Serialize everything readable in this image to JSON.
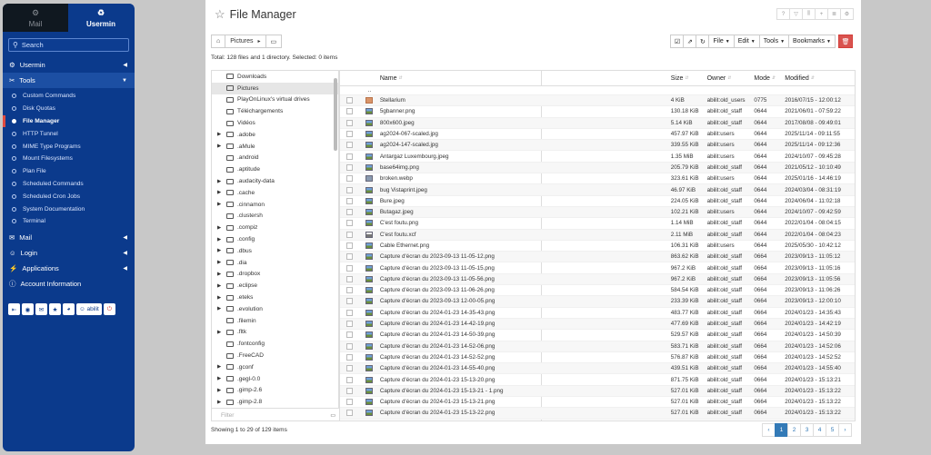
{
  "sidebar": {
    "tabs": [
      {
        "label": "Mail",
        "icon": "gear-icon"
      },
      {
        "label": "Usermin",
        "icon": "recycle-icon"
      }
    ],
    "search_placeholder": "Search",
    "sections": [
      {
        "label": "Usermin",
        "icon": "gear-icon",
        "expanded": false
      },
      {
        "label": "Tools",
        "icon": "wrench-icon",
        "expanded": true
      },
      {
        "label": "Mail",
        "icon": "envelope-icon",
        "expanded": false
      },
      {
        "label": "Login",
        "icon": "user-icon",
        "expanded": false
      },
      {
        "label": "Applications",
        "icon": "bolt-icon",
        "expanded": false
      },
      {
        "label": "Account Information",
        "icon": "info-icon",
        "expanded": false
      }
    ],
    "tools_items": [
      "Custom Commands",
      "Disk Quotas",
      "File Manager",
      "HTTP Tunnel",
      "MIME Type Programs",
      "Mount Filesystems",
      "Plan File",
      "Scheduled Commands",
      "Scheduled Cron Jobs",
      "System Documentation",
      "Terminal"
    ],
    "current_item": "File Manager",
    "username": "abilit"
  },
  "header": {
    "title": "File Manager"
  },
  "breadcrumb": {
    "current": "Pictures"
  },
  "toolbar": {
    "file_label": "File",
    "edit_label": "Edit",
    "tools_label": "Tools",
    "bookmarks_label": "Bookmarks"
  },
  "total_text": "Total: 128 files and 1 directory. Selected: 0 items",
  "tree": {
    "filter_placeholder": "Filter",
    "items": [
      {
        "name": "Downloads",
        "expandable": false,
        "selected": false
      },
      {
        "name": "Pictures",
        "expandable": false,
        "selected": true
      },
      {
        "name": "PlayOnLinux's virtual drives",
        "expandable": false,
        "selected": false
      },
      {
        "name": "Téléchargements",
        "expandable": false,
        "selected": false
      },
      {
        "name": "Vidéos",
        "expandable": false,
        "selected": false
      },
      {
        "name": ".adobe",
        "expandable": true,
        "selected": false
      },
      {
        "name": ".aMule",
        "expandable": true,
        "selected": false
      },
      {
        "name": ".android",
        "expandable": false,
        "selected": false
      },
      {
        "name": ".aptitude",
        "expandable": false,
        "selected": false
      },
      {
        "name": ".audacity-data",
        "expandable": true,
        "selected": false
      },
      {
        "name": ".cache",
        "expandable": true,
        "selected": false
      },
      {
        "name": ".cinnamon",
        "expandable": true,
        "selected": false
      },
      {
        "name": ".clustersh",
        "expandable": false,
        "selected": false
      },
      {
        "name": ".compiz",
        "expandable": true,
        "selected": false
      },
      {
        "name": ".config",
        "expandable": true,
        "selected": false
      },
      {
        "name": ".dbus",
        "expandable": true,
        "selected": false
      },
      {
        "name": ".dia",
        "expandable": true,
        "selected": false
      },
      {
        "name": ".dropbox",
        "expandable": true,
        "selected": false
      },
      {
        "name": ".eclipse",
        "expandable": true,
        "selected": false
      },
      {
        "name": ".eteks",
        "expandable": true,
        "selected": false
      },
      {
        "name": ".evolution",
        "expandable": true,
        "selected": false
      },
      {
        "name": ".filemin",
        "expandable": false,
        "selected": false
      },
      {
        "name": ".fltk",
        "expandable": true,
        "selected": false
      },
      {
        "name": ".fontconfig",
        "expandable": false,
        "selected": false
      },
      {
        "name": ".FreeCAD",
        "expandable": false,
        "selected": false
      },
      {
        "name": ".gconf",
        "expandable": true,
        "selected": false
      },
      {
        "name": ".gegl-0.0",
        "expandable": true,
        "selected": false
      },
      {
        "name": ".gimp-2.6",
        "expandable": true,
        "selected": false
      },
      {
        "name": ".gimp-2.8",
        "expandable": true,
        "selected": false
      }
    ]
  },
  "table": {
    "headers": {
      "name": "Name",
      "size": "Size",
      "owner": "Owner",
      "mode": "Mode",
      "modified": "Modified"
    },
    "parent_row": "..",
    "rows": [
      {
        "icon": "folder",
        "name": "Stellarium",
        "size": "4 KiB",
        "owner": "abilit:old_users",
        "mode": "0775",
        "modified": "2016/07/15 - 12:00:12"
      },
      {
        "icon": "img",
        "name": "5gbanner.png",
        "size": "130.18 KiB",
        "owner": "abilit:old_staff",
        "mode": "0644",
        "modified": "2021/06/01 - 07:59:22"
      },
      {
        "icon": "img",
        "name": "800x600.jpeg",
        "size": "5.14 KiB",
        "owner": "abilit:old_staff",
        "mode": "0644",
        "modified": "2017/08/08 - 09:49:01"
      },
      {
        "icon": "img",
        "name": "ag2024-067-scaled.jpg",
        "size": "457.97 KiB",
        "owner": "abilit:users",
        "mode": "0644",
        "modified": "2025/11/14 - 09:11:55"
      },
      {
        "icon": "img",
        "name": "ag2024-147-scaled.jpg",
        "size": "339.55 KiB",
        "owner": "abilit:users",
        "mode": "0644",
        "modified": "2025/11/14 - 09:12:36"
      },
      {
        "icon": "img",
        "name": "Antargaz Luxembourg.jpeg",
        "size": "1.35 MiB",
        "owner": "abilit:users",
        "mode": "0644",
        "modified": "2024/10/07 - 09:45:28"
      },
      {
        "icon": "img",
        "name": "base64img.png",
        "size": "205.79 KiB",
        "owner": "abilit:old_staff",
        "mode": "0644",
        "modified": "2021/05/12 - 10:10:49"
      },
      {
        "icon": "file",
        "name": "broken.webp",
        "size": "323.61 KiB",
        "owner": "abilit:users",
        "mode": "0644",
        "modified": "2025/01/16 - 14:46:19"
      },
      {
        "icon": "img",
        "name": "bug Vistaprint.jpeg",
        "size": "46.97 KiB",
        "owner": "abilit:old_staff",
        "mode": "0644",
        "modified": "2024/03/04 - 08:31:19"
      },
      {
        "icon": "img",
        "name": "Bure.jpeg",
        "size": "224.05 KiB",
        "owner": "abilit:old_staff",
        "mode": "0644",
        "modified": "2024/06/04 - 11:02:18"
      },
      {
        "icon": "img",
        "name": "Butagaz.jpeg",
        "size": "102.21 KiB",
        "owner": "abilit:users",
        "mode": "0644",
        "modified": "2024/10/07 - 09:42:59"
      },
      {
        "icon": "img",
        "name": "C'est foutu.png",
        "size": "1.14 MiB",
        "owner": "abilit:old_staff",
        "mode": "0644",
        "modified": "2022/01/04 - 08:04:15"
      },
      {
        "icon": "xcf",
        "name": "C'est foutu.xcf",
        "size": "2.11 MiB",
        "owner": "abilit:old_staff",
        "mode": "0644",
        "modified": "2022/01/04 - 08:04:23"
      },
      {
        "icon": "img",
        "name": "Cable Ethernet.png",
        "size": "106.31 KiB",
        "owner": "abilit:users",
        "mode": "0644",
        "modified": "2025/05/30 - 10:42:12"
      },
      {
        "icon": "img",
        "name": "Capture d'écran du 2023-09-13 11-05-12.png",
        "size": "863.62 KiB",
        "owner": "abilit:old_staff",
        "mode": "0664",
        "modified": "2023/09/13 - 11:05:12"
      },
      {
        "icon": "img",
        "name": "Capture d'écran du 2023-09-13 11-05-15.png",
        "size": "967.2 KiB",
        "owner": "abilit:old_staff",
        "mode": "0664",
        "modified": "2023/09/13 - 11:05:16"
      },
      {
        "icon": "img",
        "name": "Capture d'écran du 2023-09-13 11-05-56.png",
        "size": "967.2 KiB",
        "owner": "abilit:old_staff",
        "mode": "0664",
        "modified": "2023/09/13 - 11:05:56"
      },
      {
        "icon": "img",
        "name": "Capture d'écran du 2023-09-13 11-06-26.png",
        "size": "584.54 KiB",
        "owner": "abilit:old_staff",
        "mode": "0664",
        "modified": "2023/09/13 - 11:06:26"
      },
      {
        "icon": "img",
        "name": "Capture d'écran du 2023-09-13 12-00-05.png",
        "size": "233.39 KiB",
        "owner": "abilit:old_staff",
        "mode": "0664",
        "modified": "2023/09/13 - 12:00:10"
      },
      {
        "icon": "img",
        "name": "Capture d'écran du 2024-01-23 14-35-43.png",
        "size": "483.77 KiB",
        "owner": "abilit:old_staff",
        "mode": "0664",
        "modified": "2024/01/23 - 14:35:43"
      },
      {
        "icon": "img",
        "name": "Capture d'écran du 2024-01-23 14-42-19.png",
        "size": "477.69 KiB",
        "owner": "abilit:old_staff",
        "mode": "0664",
        "modified": "2024/01/23 - 14:42:19"
      },
      {
        "icon": "img",
        "name": "Capture d'écran du 2024-01-23 14-50-39.png",
        "size": "529.57 KiB",
        "owner": "abilit:old_staff",
        "mode": "0664",
        "modified": "2024/01/23 - 14:50:39"
      },
      {
        "icon": "img",
        "name": "Capture d'écran du 2024-01-23 14-52-06.png",
        "size": "583.71 KiB",
        "owner": "abilit:old_staff",
        "mode": "0664",
        "modified": "2024/01/23 - 14:52:06"
      },
      {
        "icon": "img",
        "name": "Capture d'écran du 2024-01-23 14-52-52.png",
        "size": "576.87 KiB",
        "owner": "abilit:old_staff",
        "mode": "0664",
        "modified": "2024/01/23 - 14:52:52"
      },
      {
        "icon": "img",
        "name": "Capture d'écran du 2024-01-23 14-55-40.png",
        "size": "439.51 KiB",
        "owner": "abilit:old_staff",
        "mode": "0664",
        "modified": "2024/01/23 - 14:55:40"
      },
      {
        "icon": "img",
        "name": "Capture d'écran du 2024-01-23 15-13-20.png",
        "size": "871.75 KiB",
        "owner": "abilit:old_staff",
        "mode": "0664",
        "modified": "2024/01/23 - 15:13:21"
      },
      {
        "icon": "img",
        "name": "Capture d'écran du 2024-01-23 15-13-21 - 1.png",
        "size": "527.01 KiB",
        "owner": "abilit:old_staff",
        "mode": "0664",
        "modified": "2024/01/23 - 15:13:22"
      },
      {
        "icon": "img",
        "name": "Capture d'écran du 2024-01-23 15-13-21.png",
        "size": "527.01 KiB",
        "owner": "abilit:old_staff",
        "mode": "0664",
        "modified": "2024/01/23 - 15:13:22"
      },
      {
        "icon": "img",
        "name": "Capture d'écran du 2024-01-23 15-13-22.png",
        "size": "527.01 KiB",
        "owner": "abilit:old_staff",
        "mode": "0664",
        "modified": "2024/01/23 - 15:13:22"
      }
    ]
  },
  "footer": {
    "showing_text": "Showing 1 to 29 of 129 items",
    "pages": [
      "1",
      "2",
      "3",
      "4",
      "5"
    ],
    "current_page": "1",
    "prev": "‹",
    "next": "›"
  },
  "colors": {
    "sidebar_bg": "#0b3a8c",
    "accent": "#337ab7",
    "delete": "#d9534f"
  }
}
